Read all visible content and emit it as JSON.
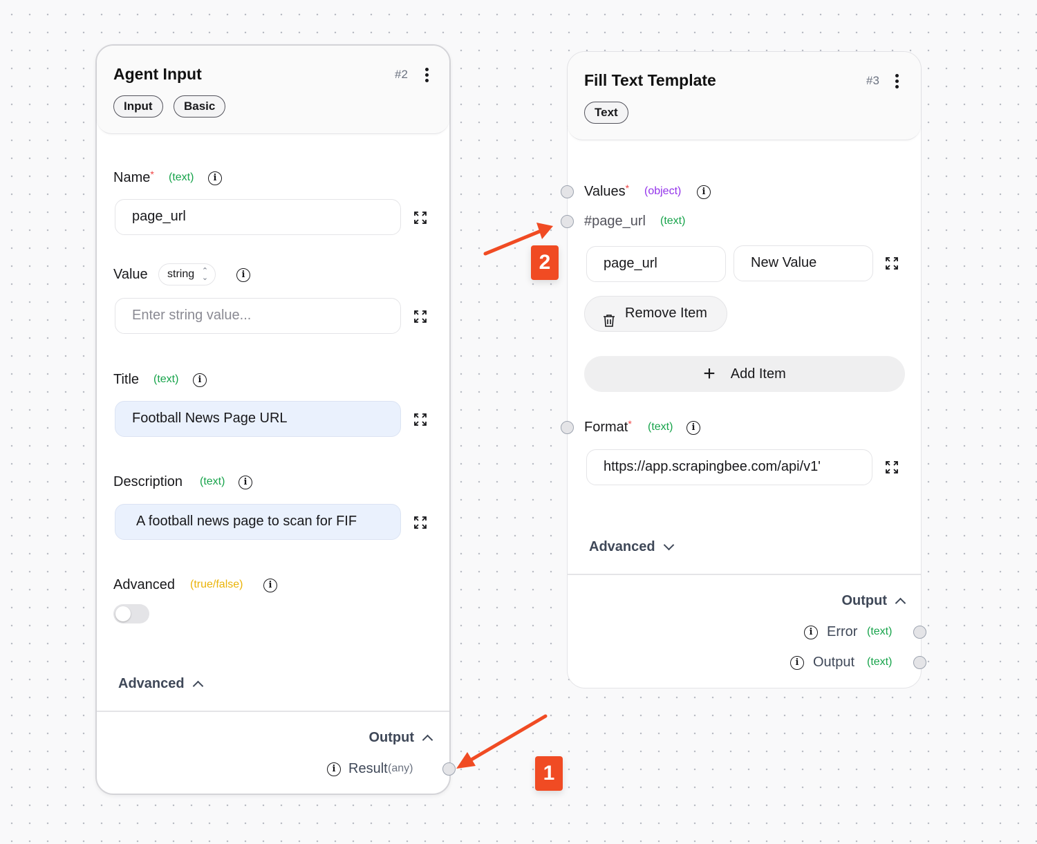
{
  "nodes": {
    "agent_input": {
      "title": "Agent Input",
      "id": "#2",
      "tags": [
        "Input",
        "Basic"
      ],
      "fields": {
        "name": {
          "label": "Name",
          "required": "*",
          "type": "(text)",
          "value": "page_url"
        },
        "value": {
          "label": "Value",
          "type_select": "string",
          "placeholder": "Enter string value..."
        },
        "title": {
          "label": "Title",
          "type": "(text)",
          "value": "Football News Page URL"
        },
        "description": {
          "label": "Description",
          "type": "(text)",
          "value": "A football news page to scan for FIF"
        },
        "advanced": {
          "label": "Advanced",
          "type": "(true/false)",
          "toggle_on": false
        }
      },
      "advanced_section": "Advanced",
      "output_section": "Output",
      "outputs": [
        {
          "label": "Result",
          "type": "(any)"
        }
      ]
    },
    "fill_text_template": {
      "title": "Fill Text Template",
      "id": "#3",
      "tags": [
        "Text"
      ],
      "values": {
        "label": "Values",
        "required": "*",
        "type": "(object)",
        "item_label": "#page_url",
        "item_type": "(text)",
        "item_key": "page_url",
        "item_value": "New Value",
        "remove_label": "Remove Item",
        "add_label": "Add Item"
      },
      "format": {
        "label": "Format",
        "required": "*",
        "type": "(text)",
        "value": "https://app.scrapingbee.com/api/v1'"
      },
      "advanced_section": "Advanced",
      "output_section": "Output",
      "outputs": [
        {
          "label": "Error",
          "type": "(text)"
        },
        {
          "label": "Output",
          "type": "(text)"
        }
      ]
    }
  },
  "annotations": [
    "1",
    "2"
  ],
  "colors": {
    "accent_marker": "#f04b23",
    "type_text": "#16a34a",
    "type_object": "#9333ea",
    "type_boolean": "#eab308",
    "required": "#ef4444",
    "filled_field": "#eaf1fd"
  },
  "icons": [
    "kebab-icon",
    "info-icon",
    "expand-icon",
    "trash-icon",
    "plus-icon",
    "chevron-up-icon",
    "chevron-down-icon",
    "arrow-annotation"
  ]
}
